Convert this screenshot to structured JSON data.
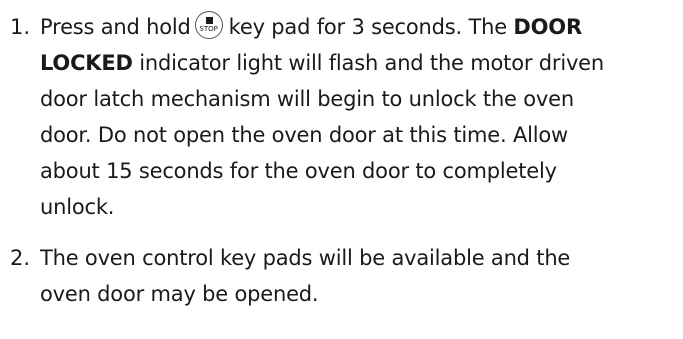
{
  "steps": [
    {
      "number": "1.",
      "line1_before_icon": "Press and hold",
      "icon_label": "STOP",
      "line1_after_icon": "key pad for 3 seconds. The ",
      "line1_bold": "DOOR",
      "line2_bold": "LOCKED",
      "line2_rest": " indicator light will flash and the motor driven",
      "line3": "door latch mechanism will begin to unlock the oven",
      "line4": "door. Do not open the oven door at this time. Allow",
      "line5": "about 15 seconds for the oven door to completely",
      "line6": "unlock."
    },
    {
      "number": "2.",
      "line1": "The oven control key pads will be available and the",
      "line2": "oven door may be opened."
    }
  ],
  "icons": {
    "stop_key": "stop-key-icon"
  }
}
